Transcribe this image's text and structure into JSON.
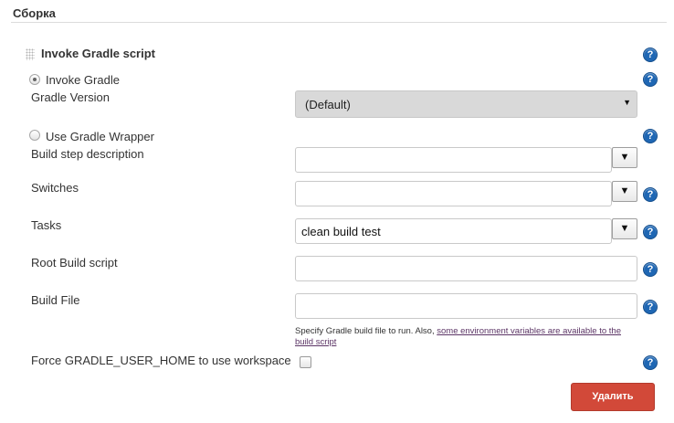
{
  "section": {
    "title": "Сборка"
  },
  "build_step": {
    "title": "Invoke Gradle script",
    "invoke_gradle": {
      "radio_label": "Invoke Gradle",
      "selected": true,
      "gradle_version_label": "Gradle Version",
      "gradle_version_value": "(Default)"
    },
    "use_wrapper": {
      "radio_label": "Use Gradle Wrapper",
      "selected": false
    },
    "fields": {
      "description": {
        "label": "Build step description",
        "value": ""
      },
      "switches": {
        "label": "Switches",
        "value": ""
      },
      "tasks": {
        "label": "Tasks",
        "value": "clean build test"
      },
      "root_build_script": {
        "label": "Root Build script",
        "value": ""
      },
      "build_file": {
        "label": "Build File",
        "value": "",
        "hint_text": "Specify Gradle build file to run. Also, ",
        "hint_link": "some environment variables are available to the build script"
      }
    },
    "force_home": {
      "label": "Force GRADLE_USER_HOME to use workspace",
      "checked": false
    },
    "dropdown_arrow": "▼",
    "delete_button": "Удалить",
    "help_glyph": "?"
  },
  "icons": {
    "drag_handle": "grip-icon",
    "help": "help-icon",
    "dropdown": "triangle-down-icon",
    "select_caret": "caret-down-icon"
  },
  "colors": {
    "help_blue": "#1f67b4",
    "delete_red": "#d24939",
    "link_purple": "#5c3566",
    "select_bg": "#d9d9d9"
  }
}
